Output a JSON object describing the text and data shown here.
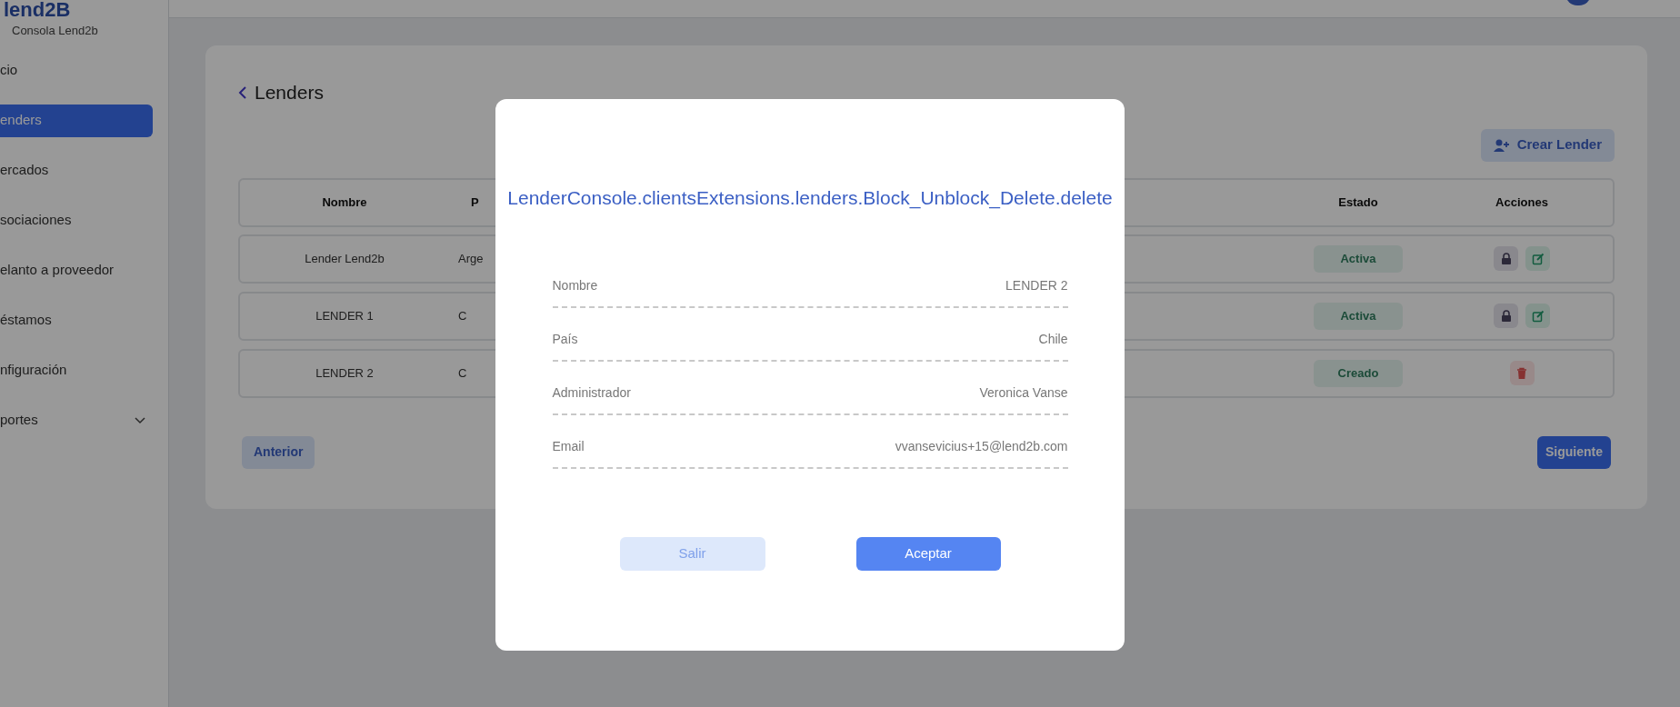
{
  "sidebar": {
    "logo": "lend2B",
    "subtitle": "Consola Lend2b",
    "items": [
      {
        "label": "cio",
        "selected": false,
        "kind": "link"
      },
      {
        "label": "enders",
        "selected": true,
        "kind": "link"
      },
      {
        "label": "ercados",
        "selected": false,
        "kind": "link"
      },
      {
        "label": "sociaciones",
        "selected": false,
        "kind": "link"
      },
      {
        "label": "elanto a proveedor",
        "selected": false,
        "kind": "link"
      },
      {
        "label": "éstamos",
        "selected": false,
        "kind": "link"
      },
      {
        "label": "nfiguración",
        "selected": false,
        "kind": "link"
      },
      {
        "label": "portes",
        "selected": false,
        "kind": "group"
      }
    ]
  },
  "page": {
    "title": "Lenders",
    "create_button": "Crear Lender",
    "table": {
      "columns": [
        "Nombre",
        "P",
        "Estado",
        "Acciones"
      ],
      "rows": [
        {
          "nombre": "Lender Lend2b",
          "column_2": "Arge",
          "estado": "Activa",
          "actions": [
            {
              "kind": "lock"
            },
            {
              "kind": "edit"
            }
          ]
        },
        {
          "nombre": "LENDER 1",
          "column_2": "C",
          "estado": "Activa",
          "actions": [
            {
              "kind": "lock"
            },
            {
              "kind": "edit"
            }
          ]
        },
        {
          "nombre": "LENDER 2",
          "column_2": "C",
          "estado": "Creado",
          "actions": [
            {
              "kind": "delete"
            }
          ]
        }
      ]
    },
    "prev_button": "Anterior",
    "next_button": "Siguiente"
  },
  "modal": {
    "title": "LenderConsole.clientsExtensions.lenders.Block_Unblock_Delete.delete",
    "fields": [
      {
        "label": "Nombre",
        "value": "LENDER 2"
      },
      {
        "label": "País",
        "value": "Chile"
      },
      {
        "label": "Administrador",
        "value": "Veronica Vanse"
      },
      {
        "label": "Email",
        "value": "vvansevicius+15@lend2b.com"
      }
    ],
    "cancel_button": "Salir",
    "accept_button": "Aceptar"
  }
}
